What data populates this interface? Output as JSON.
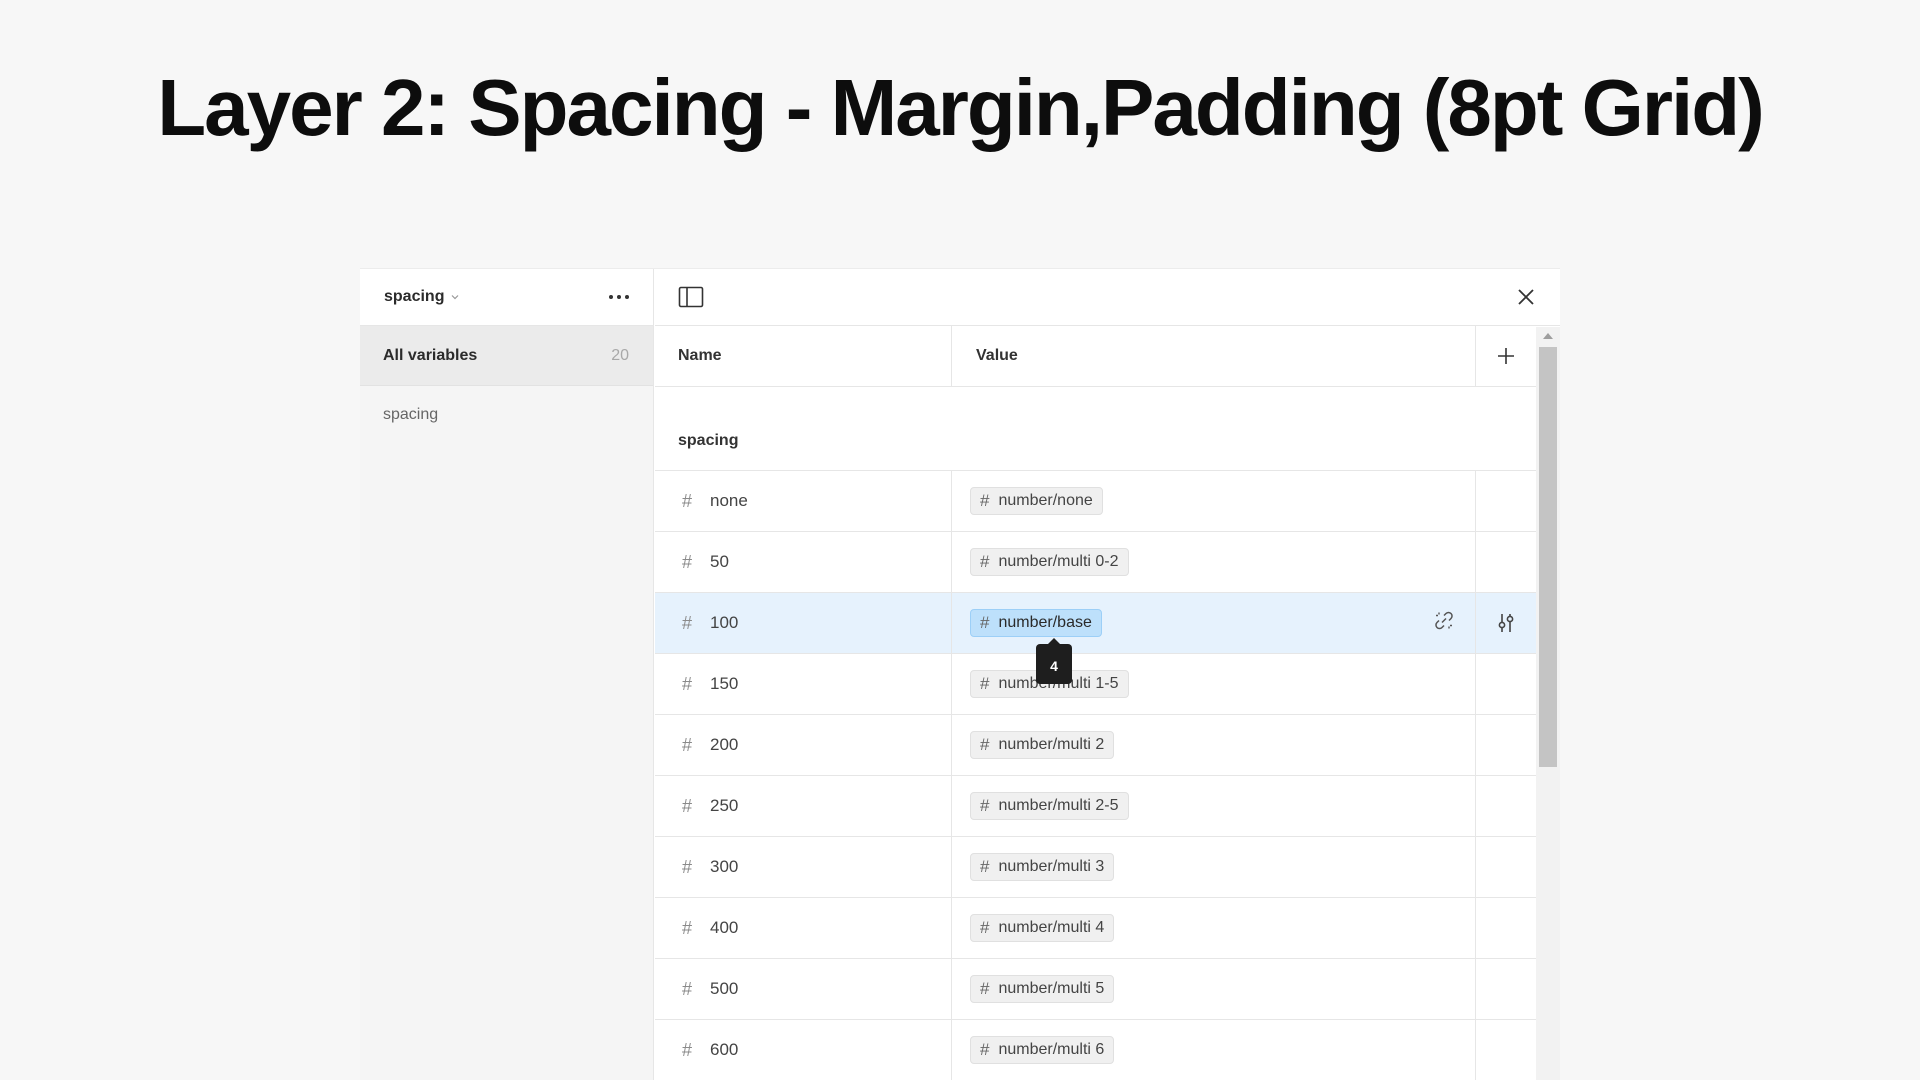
{
  "page": {
    "title": "Layer 2: Spacing - Margin,Padding (8pt Grid)"
  },
  "sidebar": {
    "collection_name": "spacing",
    "all_variables_label": "All variables",
    "all_variables_count": "20",
    "groups": [
      "spacing"
    ]
  },
  "table": {
    "header": {
      "name": "Name",
      "value": "Value"
    },
    "group_label": "spacing",
    "rows": [
      {
        "name": "none",
        "value": "number/none",
        "selected": false
      },
      {
        "name": "50",
        "value": "number/multi 0-2",
        "selected": false
      },
      {
        "name": "100",
        "value": "number/base",
        "selected": true
      },
      {
        "name": "150",
        "value": "number/multi 1-5",
        "selected": false
      },
      {
        "name": "200",
        "value": "number/multi 2",
        "selected": false
      },
      {
        "name": "250",
        "value": "number/multi 2-5",
        "selected": false
      },
      {
        "name": "300",
        "value": "number/multi 3",
        "selected": false
      },
      {
        "name": "400",
        "value": "number/multi 4",
        "selected": false
      },
      {
        "name": "500",
        "value": "number/multi 5",
        "selected": false
      },
      {
        "name": "600",
        "value": "number/multi 6",
        "selected": false
      }
    ]
  },
  "tooltip": {
    "value": "4"
  },
  "icons": {
    "toggle_sidebar": "sidebar-toggle-icon",
    "close": "close-icon",
    "add": "plus-icon",
    "detach": "detach-alias-icon",
    "edit": "sliders-icon",
    "more": "more-icon",
    "variable_type": "hash-icon"
  },
  "colors": {
    "selected_row": "#e6f2fd",
    "selected_pill": "#bde0fb",
    "tooltip_bg": "#1e1e1e"
  }
}
